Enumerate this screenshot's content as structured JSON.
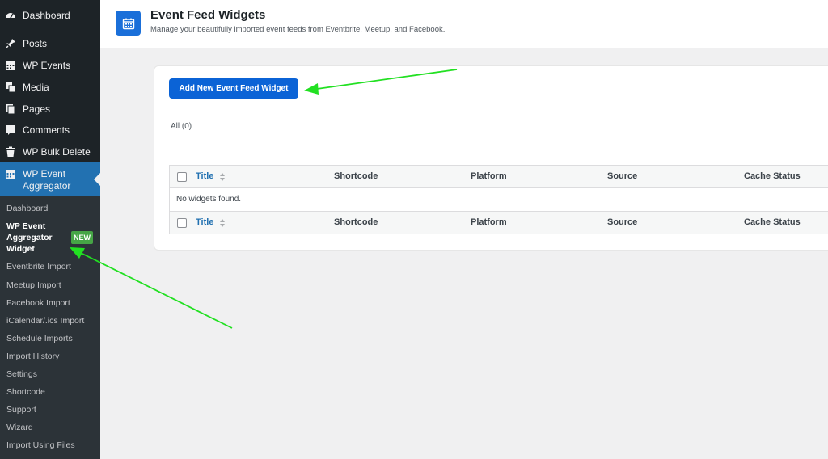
{
  "sidebar": {
    "items": [
      {
        "label": "Dashboard",
        "icon": "dashboard-icon"
      },
      {
        "label": "Posts",
        "icon": "pin-icon"
      },
      {
        "label": "WP Events",
        "icon": "calendar-icon"
      },
      {
        "label": "Media",
        "icon": "media-icon"
      },
      {
        "label": "Pages",
        "icon": "pages-icon"
      },
      {
        "label": "Comments",
        "icon": "comment-icon"
      },
      {
        "label": "WP Bulk Delete",
        "icon": "trash-icon"
      },
      {
        "label": "WP Event Aggregator",
        "icon": "calendar-icon"
      }
    ],
    "submenu": [
      {
        "label": "Dashboard"
      },
      {
        "label": "WP Event Aggregator Widget"
      },
      {
        "label": "Eventbrite Import"
      },
      {
        "label": "Meetup Import"
      },
      {
        "label": "Facebook Import"
      },
      {
        "label": "iCalendar/.ics Import"
      },
      {
        "label": "Schedule Imports"
      },
      {
        "label": "Import History"
      },
      {
        "label": "Settings"
      },
      {
        "label": "Shortcode"
      },
      {
        "label": "Support"
      },
      {
        "label": "Wizard"
      },
      {
        "label": "Import Using Files"
      }
    ],
    "new_badge": "NEW"
  },
  "header": {
    "title": "Event Feed Widgets",
    "subtitle": "Manage your beautifully imported event feeds from Eventbrite, Meetup, and Facebook.",
    "icon": "calendar-icon"
  },
  "main": {
    "add_button": "Add New Event Feed Widget",
    "filter_all": "All (0)",
    "table": {
      "columns": [
        "Title",
        "Shortcode",
        "Platform",
        "Source",
        "Cache Status"
      ],
      "empty_message": "No widgets found."
    }
  },
  "colors": {
    "sidebar_bg": "#1d2327",
    "active_menu": "#2271b1",
    "primary_button": "#0b63d6",
    "badge_green": "#46a546",
    "annotation_arrow": "#22e022"
  }
}
